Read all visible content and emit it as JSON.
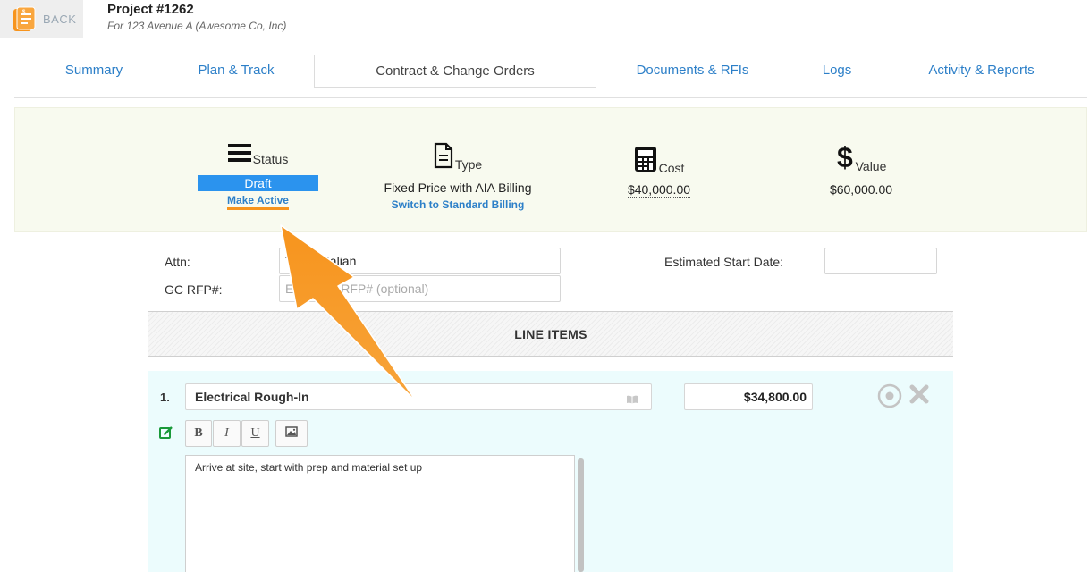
{
  "header": {
    "back_label": "BACK",
    "project_title": "Project #1262",
    "project_subtitle": "For 123 Avenue A (Awesome Co, Inc)"
  },
  "tabs": [
    {
      "label": "Summary"
    },
    {
      "label": "Plan & Track"
    },
    {
      "label": "Contract & Change Orders",
      "active": true
    },
    {
      "label": "Documents & RFIs"
    },
    {
      "label": "Logs"
    },
    {
      "label": "Activity & Reports"
    }
  ],
  "summary": {
    "status": {
      "label": "Status",
      "value": "Draft",
      "action": "Make Active",
      "icon": "menu-icon"
    },
    "type": {
      "label": "Type",
      "value": "Fixed Price with AIA Billing",
      "action": "Switch to Standard Billing",
      "icon": "document-icon"
    },
    "cost": {
      "label": "Cost",
      "value": "$40,000.00",
      "icon": "calculator-icon"
    },
    "value": {
      "label": "Value",
      "value": "$60,000.00",
      "icon": "dollar-icon"
    }
  },
  "form": {
    "attn_label": "Attn:",
    "attn_value": "Tessa Kalian",
    "gc_rfp_label": "GC RFP#:",
    "gc_rfp_placeholder": "Enter GC RFP# (optional)",
    "start_date_label": "Estimated Start Date:",
    "start_date_value": ""
  },
  "line_items": {
    "header": "LINE ITEMS",
    "items": [
      {
        "number": "1.",
        "name": "Electrical Rough-In",
        "amount": "$34,800.00",
        "description": "Arrive at site, start with prep and material set up"
      }
    ],
    "toolbar": {
      "bold": "B",
      "italic": "I",
      "underline": "U"
    }
  },
  "colors": {
    "link_blue": "#2c7fc8",
    "badge_blue": "#2b93ee",
    "accent_orange": "#f7941d",
    "summary_bg": "#f8faef",
    "line_item_bg": "#ecfcfd"
  }
}
